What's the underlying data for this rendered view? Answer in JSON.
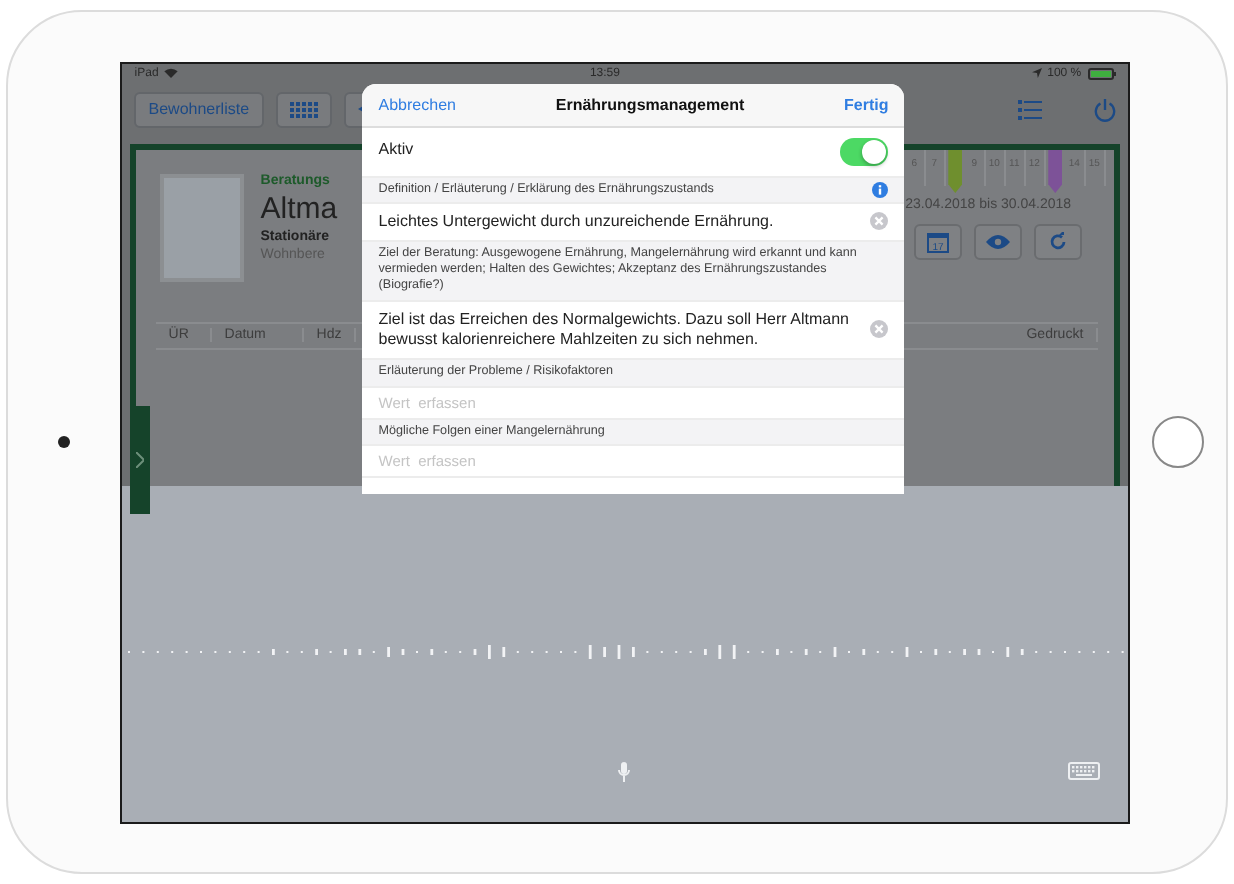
{
  "status_bar": {
    "device": "iPad",
    "time": "13:59",
    "battery": "100 %"
  },
  "toolbar": {
    "back_label": "Bewohnerliste"
  },
  "resident": {
    "section": "Beratungs",
    "name": "Altma",
    "line_1": "Stationäre",
    "line_2": "Wohnbere",
    "date_range": "23.04.2018 bis 30.04.2018",
    "calendar_day": "17"
  },
  "day_strip": [
    {
      "kind": "day",
      "label": "6"
    },
    {
      "kind": "day",
      "label": "7"
    },
    {
      "kind": "marker",
      "color": "#6f8f2e"
    },
    {
      "kind": "day",
      "label": "9"
    },
    {
      "kind": "day",
      "label": "10"
    },
    {
      "kind": "day",
      "label": "11"
    },
    {
      "kind": "day",
      "label": "12"
    },
    {
      "kind": "marker",
      "color": "#7d5298"
    },
    {
      "kind": "day",
      "label": "14"
    },
    {
      "kind": "day",
      "label": "15"
    }
  ],
  "table": {
    "columns": [
      "ÜR",
      "Datum",
      "Hdz",
      "Gedruckt"
    ]
  },
  "modal": {
    "cancel": "Abbrechen",
    "title": "Ernährungsmanagement",
    "done": "Fertig",
    "rows": [
      {
        "kind": "toggle",
        "label": "Aktiv",
        "on": true
      },
      {
        "kind": "section",
        "label": "Definition / Erläuterung / Erklärung des Ernährungszustands",
        "info": true
      },
      {
        "kind": "value",
        "value": "Leichtes Untergewicht durch unzureichende Ernährung."
      },
      {
        "kind": "section",
        "label": "Ziel der Beratung: Ausgewogene Ernährung, Mangelernährung wird erkannt und kann vermieden werden; Halten des Gewichtes; Akzeptanz des Ernährungszustandes (Biografie?)",
        "info": false
      },
      {
        "kind": "value",
        "value": "Ziel ist das Erreichen des Normalgewichts. Dazu soll Herr Altmann bewusst kalorienreichere Mahlzeiten zu sich nehmen."
      },
      {
        "kind": "section",
        "label": "Erläuterung der Probleme / Risikofaktoren",
        "info": false
      },
      {
        "kind": "empty",
        "placeholder": "Wert  erfassen"
      },
      {
        "kind": "section",
        "label": "Mögliche Folgen einer Mangelernährung",
        "info": false
      },
      {
        "kind": "empty",
        "placeholder": "Wert  erfassen"
      }
    ]
  }
}
